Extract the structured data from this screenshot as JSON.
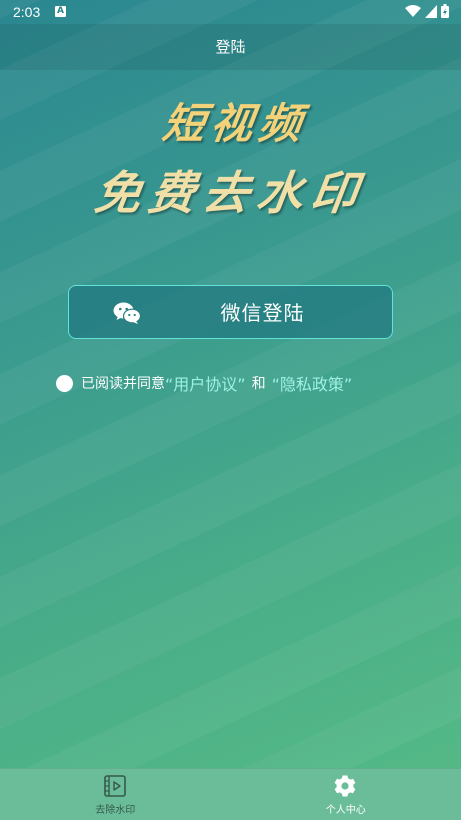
{
  "status_bar": {
    "time": "2:03",
    "notification_glyph": "A",
    "icons": [
      "wifi-icon",
      "signal-icon",
      "battery-icon"
    ]
  },
  "header": {
    "title": "登陆"
  },
  "hero": {
    "line1": "短视频",
    "line2": "免费去水印"
  },
  "login": {
    "wechat_label": "微信登陆",
    "icon": "wechat-icon"
  },
  "agreement": {
    "prefix": "已阅读并同意",
    "user_agreement": "“用户协议”",
    "and": "和",
    "privacy_policy": "“隐私政策”",
    "checked": false
  },
  "bottom_nav": {
    "items": [
      {
        "label": "去除水印",
        "icon": "video-icon",
        "active": false
      },
      {
        "label": "个人中心",
        "icon": "gear-icon",
        "active": true
      }
    ]
  },
  "colors": {
    "accent_border": "#5fe3da",
    "link": "#9ff0e4",
    "hero_gold": "#f3d27a",
    "nav_bg": "#6bbd9a"
  }
}
